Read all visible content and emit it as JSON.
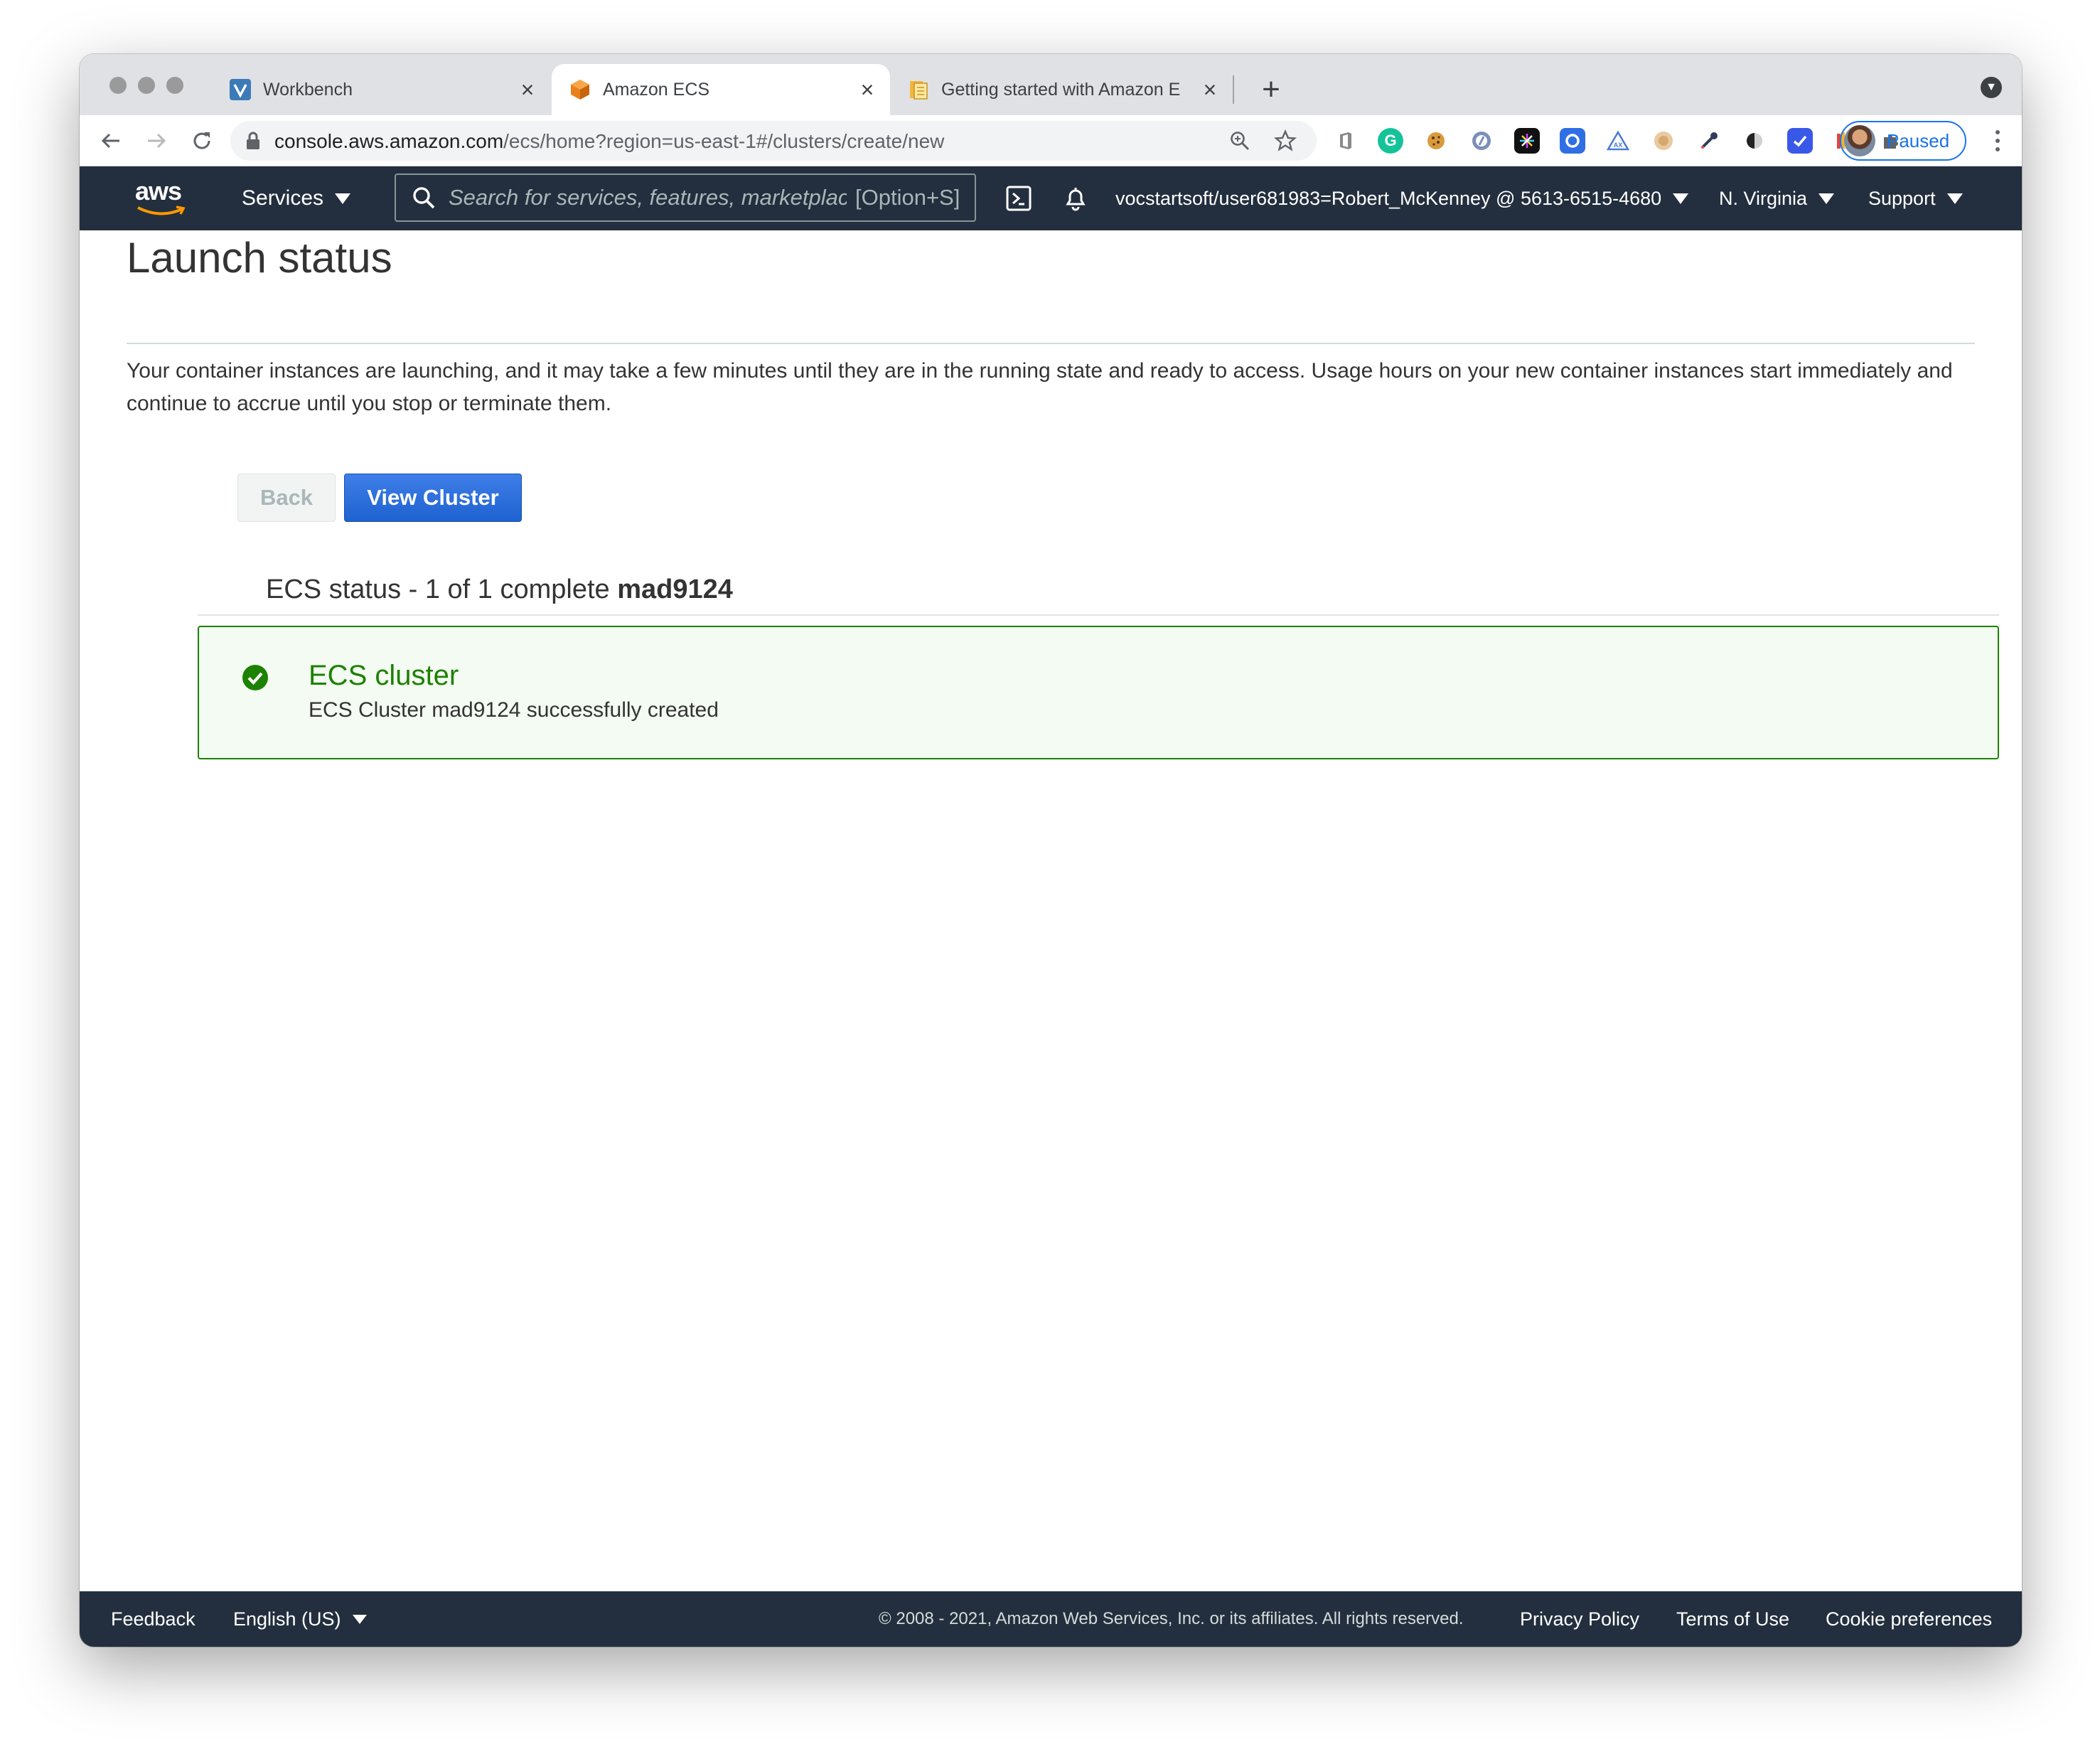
{
  "browser": {
    "tabs": [
      {
        "label": "Workbench",
        "favicon": "vocareum-v-icon",
        "active": false
      },
      {
        "label": "Amazon ECS",
        "favicon": "aws-cube-icon",
        "active": true
      },
      {
        "label": "Getting started with Amazon E",
        "favicon": "docs-book-icon",
        "active": false
      }
    ],
    "new_tab": "+",
    "url_host": "console.aws.amazon.com",
    "url_path": "/ecs/home?region=us-east-1#/clusters/create/new",
    "profile_label": "Paused"
  },
  "aws_nav": {
    "logo": "aws",
    "services_label": "Services",
    "search_placeholder": "Search for services, features, marketplac",
    "search_shortcut": "[Option+S]",
    "account_label": "vocstartsoft/user681983=Robert_McKenney @ 5613-6515-4680",
    "region_label": "N. Virginia",
    "support_label": "Support"
  },
  "page": {
    "title": "Launch status",
    "description": "Your container instances are launching, and it may take a few minutes until they are in the running state and ready to access. Usage hours on your new container instances start immediately and continue to accrue until you stop or terminate them.",
    "back_label": "Back",
    "view_cluster_label": "View Cluster",
    "status_heading_prefix": "ECS status - 1 of 1 complete",
    "status_heading_cluster": "mad9124",
    "status_item": {
      "title": "ECS cluster",
      "message": "ECS Cluster mad9124 successfully created"
    }
  },
  "footer": {
    "feedback": "Feedback",
    "language": "English (US)",
    "copyright": "© 2008 - 2021, Amazon Web Services, Inc. or its affiliates. All rights reserved.",
    "privacy": "Privacy Policy",
    "terms": "Terms of Use",
    "cookies": "Cookie preferences"
  },
  "colors": {
    "aws_nav_bg": "#232f3e",
    "success_green": "#1d8102",
    "primary_button": "#1e62d0"
  }
}
